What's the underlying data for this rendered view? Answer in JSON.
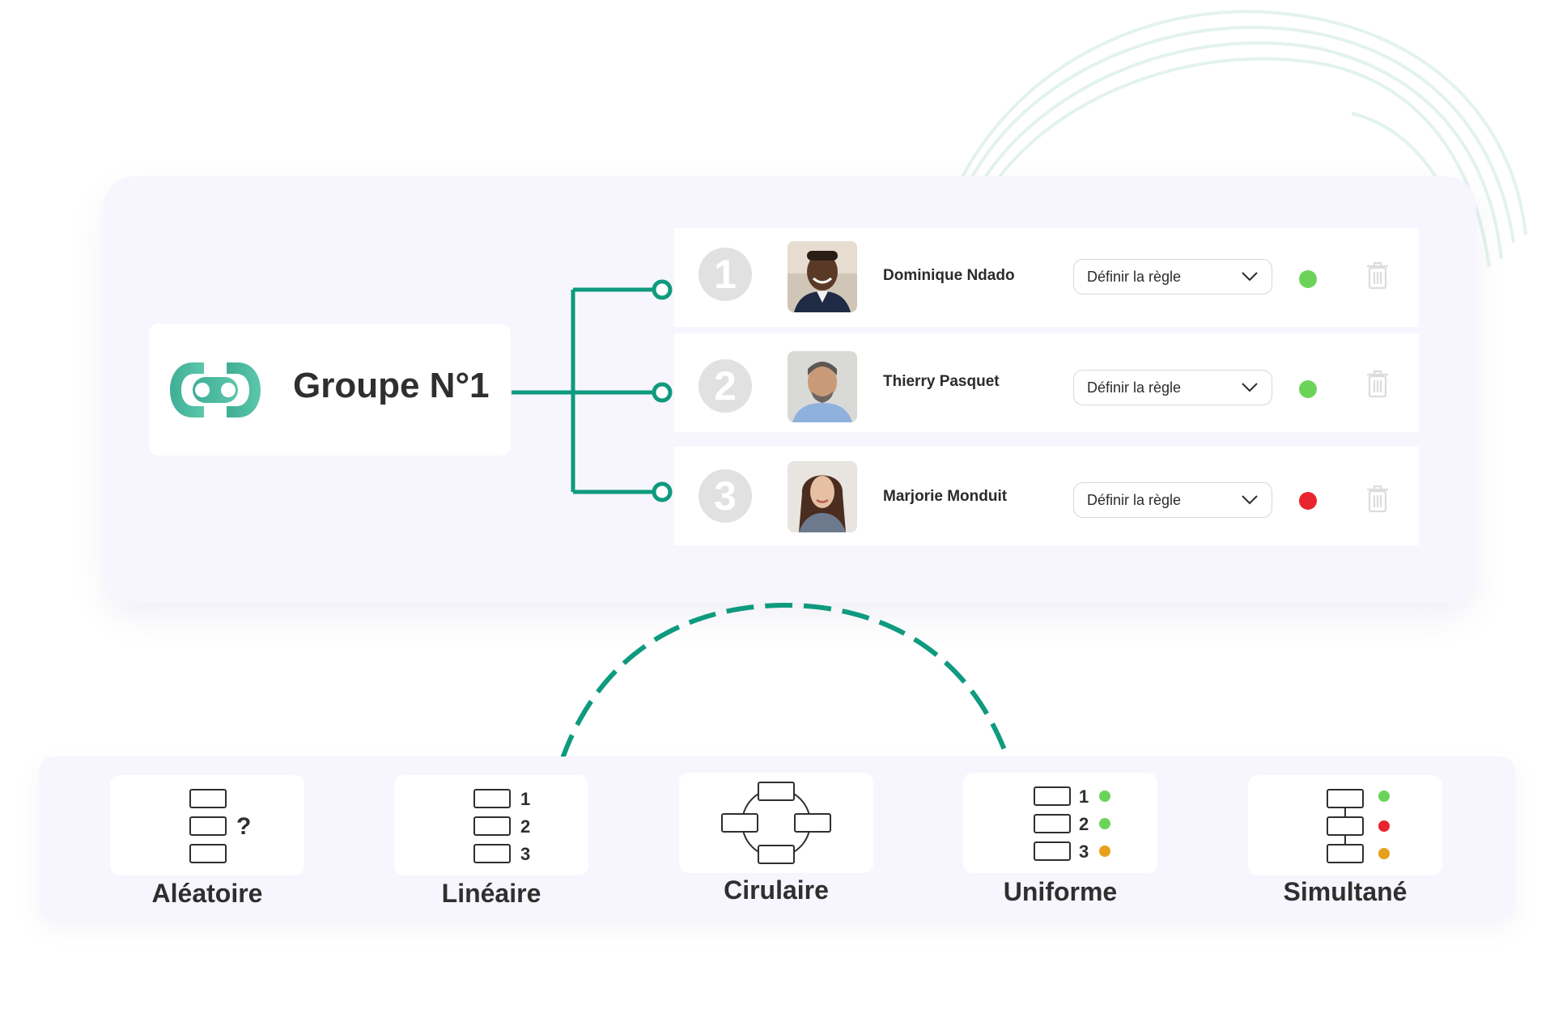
{
  "group": {
    "title": "Groupe N°1",
    "logo_icon": "group-link-icon",
    "accent_color": "#0e9a7e"
  },
  "members": [
    {
      "number": "1",
      "name": "Dominique Ndado",
      "rule_label": "Définir la règle",
      "status_color": "#6cd35a",
      "status": "green"
    },
    {
      "number": "2",
      "name": "Thierry Pasquet",
      "rule_label": "Définir la règle",
      "status_color": "#6cd35a",
      "status": "green"
    },
    {
      "number": "3",
      "name": "Marjorie Monduit",
      "rule_label": "Définir la règle",
      "status_color": "#e8252f",
      "status": "red"
    }
  ],
  "modes": [
    {
      "label": "Aléatoire",
      "icon": "random-order-icon"
    },
    {
      "label": "Linéaire",
      "icon": "linear-order-icon",
      "numbers": [
        "1",
        "2",
        "3"
      ]
    },
    {
      "label": "Cirulaire",
      "icon": "circular-order-icon"
    },
    {
      "label": "Uniforme",
      "icon": "uniform-order-icon",
      "numbers": [
        "1",
        "2",
        "3"
      ]
    },
    {
      "label": "Simultané",
      "icon": "simultaneous-order-icon"
    }
  ],
  "random_marker": "?",
  "colors": {
    "green": "#6cd35a",
    "red": "#e8252f",
    "orange": "#e8a11a",
    "card_bg": "#f7f5fd"
  }
}
